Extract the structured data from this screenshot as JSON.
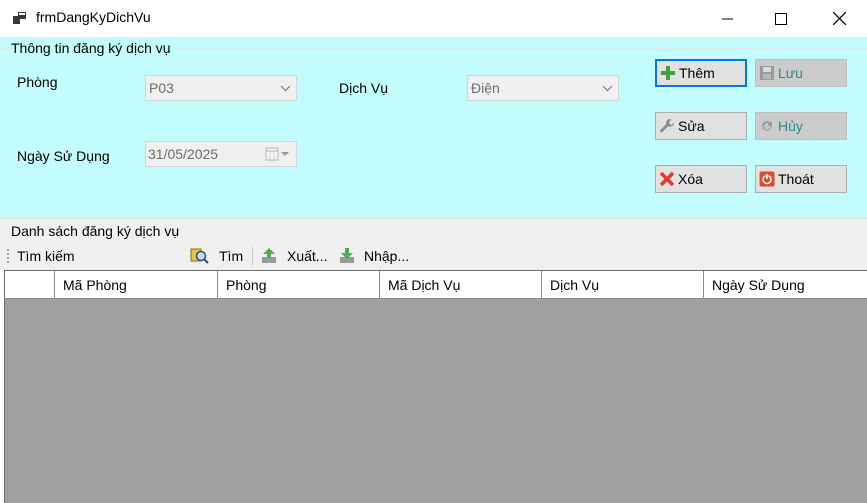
{
  "window": {
    "title": "frmDangKyDichVu",
    "icon": "app-window-icon"
  },
  "info_group": {
    "legend": "Thông tin đăng ký dịch vụ",
    "phong_label": "Phòng",
    "phong_value": "P03",
    "dichvu_label": "Dịch Vụ",
    "dichvu_value": "Điện",
    "ngay_label": "Ngày Sử Dụng",
    "ngay_value": "31/05/2025"
  },
  "buttons": {
    "them": "Thêm",
    "luu": "Lưu",
    "sua": "Sửa",
    "huy": "Hủy",
    "xoa": "Xóa",
    "thoat": "Thoát"
  },
  "list_group": {
    "legend": "Danh sách đăng ký dịch vụ"
  },
  "toolbar": {
    "search_label": "Tìm kiếm",
    "search_value": "",
    "find": "Tìm",
    "export": "Xuất...",
    "import": "Nhập..."
  },
  "grid": {
    "columns": [
      "",
      "Mã Phòng",
      "Phòng",
      "Mã Dịch Vụ",
      "Dịch Vụ",
      "Ngày Sử Dụng"
    ],
    "rows": []
  },
  "colors": {
    "panel_bg": "#c2fcfc",
    "grid_bg": "#a0a0a0",
    "focus_border": "#0078d7"
  }
}
